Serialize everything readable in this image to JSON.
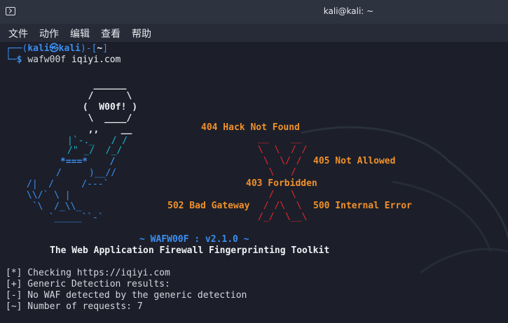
{
  "window": {
    "title": "kali@kali: ~"
  },
  "menu": [
    "文件",
    "动作",
    "编辑",
    "查看",
    "帮助"
  ],
  "prompt": {
    "frame_top_left": "┌──(",
    "user_host": "kali㉿kali",
    "frame_top_right": ")-[",
    "cwd": "~",
    "frame_close": "]",
    "frame_bottom": "└─",
    "symbol": "$",
    "command": "wafw00f",
    "argument": "iqiyi.com"
  },
  "banner": {
    "bubble": [
      "   ______",
      "  /      \\",
      " (  W00f! )",
      "  \\  ____/",
      "  ,,    __"
    ],
    "dog_white": [
      "|`-._   / /",
      "/\" _/  /_/"
    ],
    "dog_blue": [
      "*===*    /",
      "/     )__//",
      "/|  /     /---`",
      "\\\\/` \\ |",
      " `\\  /_\\\\_",
      "   `_____``-`"
    ],
    "messages": {
      "m404": "404 Hack Not Found",
      "m405": "405 Not Allowed",
      "m403": "403 Forbidden",
      "m502": "502 Bad Gateway",
      "m500": "500 Internal Error"
    },
    "x_art": [
      "__    __",
      "\\  \\  / /",
      " \\  \\/ /",
      "  \\   /",
      "  /   \\",
      " / /\\  \\",
      "/_/  \\__\\"
    ],
    "version": "~ WAFW00F : v2.1.0 ~",
    "tagline": "The Web Application Firewall Fingerprinting Toolkit"
  },
  "output": [
    "[*] Checking https://iqiyi.com",
    "[+] Generic Detection results:",
    "[-] No WAF detected by the generic detection",
    "[~] Number of requests: 7"
  ]
}
